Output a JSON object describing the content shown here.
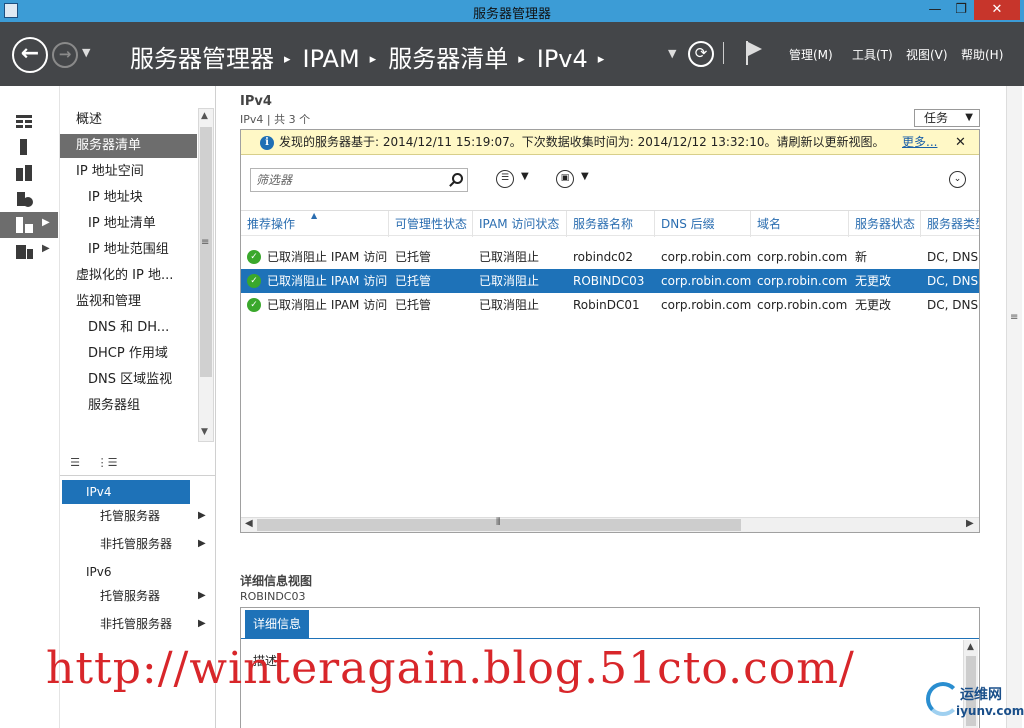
{
  "window": {
    "title": "服务器管理器",
    "minimize": "—",
    "maximize": "❐",
    "close": "✕"
  },
  "header": {
    "breadcrumbs": [
      "服务器管理器",
      "IPAM",
      "服务器清单",
      "IPv4"
    ],
    "menu": {
      "manage": "管理(M)",
      "tools": "工具(T)",
      "view": "视图(V)",
      "help": "帮助(H)"
    }
  },
  "tree": {
    "items": [
      "概述",
      "服务器清单",
      "IP 地址空间",
      "IP 地址块",
      "IP 地址清单",
      "IP 地址范围组",
      "虚拟化的 IP 地...",
      "监视和管理",
      "DNS 和 DH...",
      "DHCP 作用域",
      "DNS 区域监视",
      "服务器组"
    ],
    "selected_index": 1
  },
  "nav2": {
    "ipv4": "IPv4",
    "ipv4_managed": "托管服务器",
    "ipv4_unmanaged": "非托管服务器",
    "ipv6": "IPv6",
    "ipv6_managed": "托管服务器",
    "ipv6_unmanaged": "非托管服务器"
  },
  "content": {
    "title": "IPv4",
    "subtitle": "IPv4 | 共 3 个",
    "tasks_label": "任务",
    "info": {
      "message": "发现的服务器基于: 2014/12/11 15:19:07。下次数据收集时间为: 2014/12/12 13:32:10。请刷新以更新视图。",
      "more": "更多...",
      "close": "✕"
    },
    "filter_placeholder": "筛选器",
    "columns": [
      "推荐操作",
      "可管理性状态",
      "IPAM 访问状态",
      "服务器名称",
      "DNS 后缀",
      "域名",
      "服务器状态",
      "服务器类型"
    ],
    "rows": [
      [
        "已取消阻止 IPAM 访问",
        "已托管",
        "已取消阻止",
        "robindc02",
        "corp.robin.com",
        "corp.robin.com",
        "新",
        "DC, DNS"
      ],
      [
        "已取消阻止 IPAM 访问",
        "已托管",
        "已取消阻止",
        "ROBINDC03",
        "corp.robin.com",
        "corp.robin.com",
        "无更改",
        "DC, DNS"
      ],
      [
        "已取消阻止 IPAM 访问",
        "已托管",
        "已取消阻止",
        "RobinDC01",
        "corp.robin.com",
        "corp.robin.com",
        "无更改",
        "DC, DNS"
      ]
    ],
    "selected_row": 1
  },
  "details": {
    "title": "详细信息视图",
    "server": "ROBINDC03",
    "tab": "详细信息",
    "description_label": "描述:"
  },
  "watermark": "http://winteragain.blog.51cto.com/",
  "corner_logo": {
    "cn": "运维网",
    "en": "iyunv.com"
  },
  "colors": {
    "titlebar": "#3c9cd6",
    "header": "#444649",
    "selection": "#1e72b8",
    "ok": "#3aa82c"
  }
}
